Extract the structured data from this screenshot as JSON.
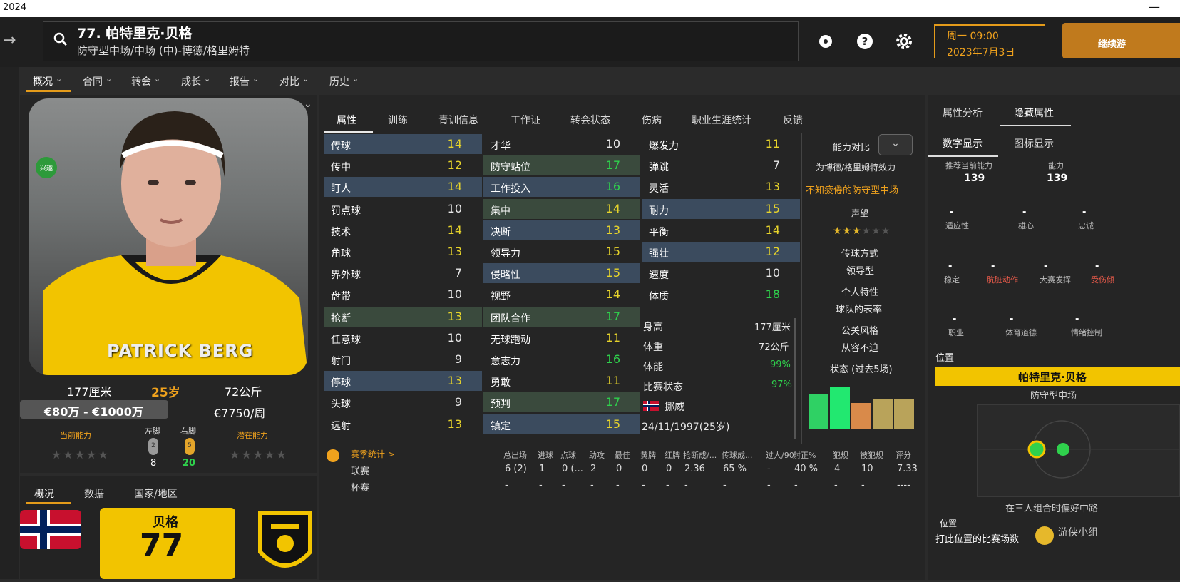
{
  "window": {
    "title": "2024",
    "minimize": "—"
  },
  "header": {
    "player_title": "77. 帕特里克·贝格",
    "subtitle": "防守型中场/中场 (中)-博德/格里姆特",
    "date_line1": "周一 09:00",
    "date_line2": "2023年7月3日",
    "continue_label": "继续游"
  },
  "nav": {
    "items": [
      "概况",
      "合同",
      "转会",
      "成长",
      "报告",
      "对比",
      "历史"
    ]
  },
  "profile": {
    "badge": "兴趣",
    "shirt_name": "PATRICK BERG",
    "height": "177厘米",
    "age": "25岁",
    "weight": "72公斤",
    "value": "€80万 - €1000万",
    "wage": "€7750/周",
    "current_ability_label": "当前能力",
    "potential_ability_label": "潜在能力",
    "left_foot_label": "左脚",
    "right_foot_label": "右脚",
    "left_foot_value": "8",
    "right_foot_value": "20",
    "left_foot_icon_num": "2",
    "right_foot_icon_num": "5",
    "bottom_tabs": [
      "概况",
      "数据",
      "国家/地区"
    ],
    "card_name": "贝格",
    "card_number": "77"
  },
  "tabs": [
    "属性",
    "训练",
    "青训信息",
    "工作证",
    "转会状态",
    "伤病",
    "职业生涯统计",
    "反馈"
  ],
  "attributes": {
    "technical": [
      {
        "name": "传球",
        "value": "14",
        "hl": "b"
      },
      {
        "name": "传中",
        "value": "12",
        "hl": ""
      },
      {
        "name": "盯人",
        "value": "14",
        "hl": "b"
      },
      {
        "name": "罚点球",
        "value": "10",
        "hl": ""
      },
      {
        "name": "技术",
        "value": "14",
        "hl": ""
      },
      {
        "name": "角球",
        "value": "13",
        "hl": ""
      },
      {
        "name": "界外球",
        "value": "7",
        "hl": ""
      },
      {
        "name": "盘带",
        "value": "10",
        "hl": ""
      },
      {
        "name": "抢断",
        "value": "13",
        "hl": "g"
      },
      {
        "name": "任意球",
        "value": "10",
        "hl": ""
      },
      {
        "name": "射门",
        "value": "9",
        "hl": ""
      },
      {
        "name": "停球",
        "value": "13",
        "hl": "b"
      },
      {
        "name": "头球",
        "value": "9",
        "hl": ""
      },
      {
        "name": "远射",
        "value": "13",
        "hl": ""
      }
    ],
    "mental": [
      {
        "name": "才华",
        "value": "10",
        "hl": ""
      },
      {
        "name": "防守站位",
        "value": "17",
        "hl": "g"
      },
      {
        "name": "工作投入",
        "value": "16",
        "hl": "b"
      },
      {
        "name": "集中",
        "value": "14",
        "hl": "g"
      },
      {
        "name": "决断",
        "value": "13",
        "hl": "b"
      },
      {
        "name": "领导力",
        "value": "15",
        "hl": ""
      },
      {
        "name": "侵略性",
        "value": "15",
        "hl": "b"
      },
      {
        "name": "视野",
        "value": "14",
        "hl": ""
      },
      {
        "name": "团队合作",
        "value": "17",
        "hl": "g"
      },
      {
        "name": "无球跑动",
        "value": "11",
        "hl": ""
      },
      {
        "name": "意志力",
        "value": "16",
        "hl": ""
      },
      {
        "name": "勇敢",
        "value": "11",
        "hl": ""
      },
      {
        "name": "预判",
        "value": "17",
        "hl": "g"
      },
      {
        "name": "镇定",
        "value": "15",
        "hl": "b"
      }
    ],
    "physical": [
      {
        "name": "爆发力",
        "value": "11",
        "hl": ""
      },
      {
        "name": "弹跳",
        "value": "7",
        "hl": ""
      },
      {
        "name": "灵活",
        "value": "13",
        "hl": ""
      },
      {
        "name": "耐力",
        "value": "15",
        "hl": "b"
      },
      {
        "name": "平衡",
        "value": "14",
        "hl": ""
      },
      {
        "name": "强壮",
        "value": "12",
        "hl": "b"
      },
      {
        "name": "速度",
        "value": "10",
        "hl": ""
      },
      {
        "name": "体质",
        "value": "18",
        "hl": ""
      }
    ]
  },
  "info": {
    "height_label": "身高",
    "height_value": "177厘米",
    "weight_label": "体重",
    "weight_value": "72公斤",
    "fitness_label": "体能",
    "fitness_value": "99%",
    "match_label": "比赛状态",
    "match_value": "97%",
    "nation": "挪威",
    "dob": "24/11/1997(25岁)"
  },
  "compare": {
    "label": "能力对比",
    "for_club": "为博德/格里姆特效力",
    "role": "不知疲倦的防守型中场",
    "reputation_label": "声望",
    "style_label": "传球方式",
    "style_value": "领导型",
    "traits_label": "个人特性",
    "traits_value": "球队的表率",
    "media_label": "公关风格",
    "media_value": "从容不迫",
    "form_label": "状态 (过去5场)",
    "form_bars": [
      0.75,
      0.9,
      0.55,
      0.62,
      0.62
    ],
    "form_colors": [
      "#2fd164",
      "#22e870",
      "#d98a4a",
      "#b9a35a",
      "#b9a35a"
    ]
  },
  "season": {
    "title": "赛季统计 >",
    "columns": [
      "总出场",
      "进球",
      "点球",
      "助攻",
      "最佳",
      "黄牌",
      "红牌",
      "抢断成/...",
      "传球成...",
      "过人/90",
      "射正%",
      "犯规",
      "被犯规",
      "评分"
    ],
    "rows": [
      {
        "label": "联赛",
        "values": [
          "6 (2)",
          "1",
          "0 (...",
          "2",
          "0",
          "0",
          "0",
          "2.36",
          "65 %",
          "-",
          "40 %",
          "4",
          "10",
          "7.33"
        ]
      },
      {
        "label": "杯赛",
        "values": [
          "-",
          "-",
          "-",
          "-",
          "-",
          "-",
          "-",
          "-",
          "-",
          "-",
          "-",
          "-",
          "-",
          "----"
        ]
      }
    ]
  },
  "right": {
    "tabs": [
      "属性分析",
      "隐藏属性"
    ],
    "subtabs": [
      "数字显示",
      "图标显示"
    ],
    "ca_label": "推荐当前能力",
    "ca_value": "139",
    "ca2_label": "能力",
    "ca2_value": "139",
    "hidden_row1": [
      "适应性",
      "雄心",
      "忠诚"
    ],
    "hidden_row2": [
      "稳定",
      "肮脏动作",
      "大赛发挥",
      "受伤倾"
    ],
    "hidden_row3": [
      "职业",
      "体育道德",
      "情绪控制"
    ],
    "dash": "-",
    "position_label": "位置",
    "position_name": "帕特里克·贝格",
    "position_role": "防守型中场",
    "position_note": "在三人组合时偏好中路",
    "position_count": "打此位置的比赛场数",
    "small_label": "位置"
  },
  "watermark": "游侠小组"
}
